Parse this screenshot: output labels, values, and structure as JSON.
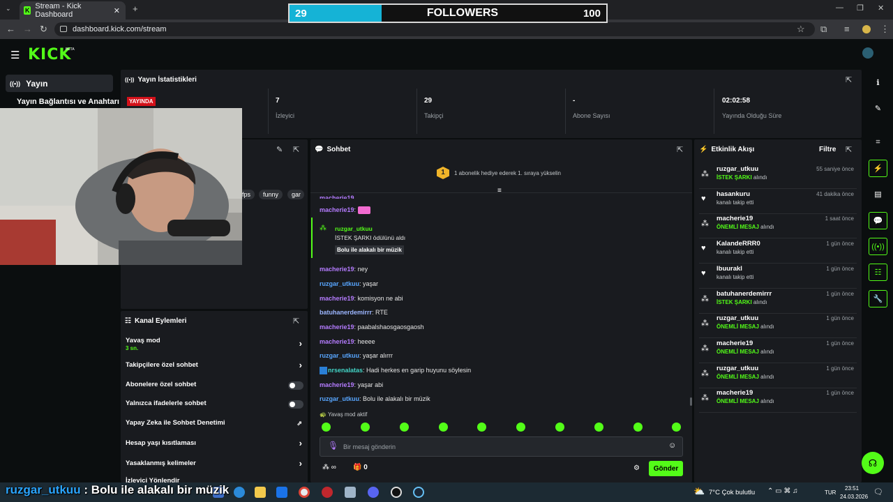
{
  "browser": {
    "tab_title": "Stream - Kick Dashboard",
    "url": "dashboard.kick.com/stream",
    "favicon_letter": "K"
  },
  "overlay": {
    "followers_current": "29",
    "followers_label": "FOLLOWERS",
    "followers_target": "100",
    "progress_fraction": 0.29
  },
  "kick": {
    "logo": "KICK",
    "beta": "BETA"
  },
  "sidebar": {
    "items": [
      {
        "label": "Yayın"
      },
      {
        "label": "Yayın Bağlantısı ve Anahtarı"
      }
    ]
  },
  "stats": {
    "title": "Yayın İstatistikleri",
    "live_badge": "YAYINDA",
    "items": [
      {
        "value": "7",
        "label": "İzleyici"
      },
      {
        "value": "29",
        "label": "Takipçi"
      },
      {
        "value": "-",
        "label": "Abone Sayısı"
      },
      {
        "value": "02:02:58",
        "label": "Yayında Olduğu Süre"
      }
    ]
  },
  "tags": [
    "fps",
    "funny",
    "gar"
  ],
  "chat": {
    "title": "Sohbet",
    "goal_badge": "1",
    "goal_text": "1 abonelik hediye ederek 1. sıraya yükselin",
    "reward": {
      "user": "ruzgar_utkuu",
      "line": "İSTEK ŞARKI ödülünü aldı",
      "message": "Bolu ile alakalı bir müzik"
    },
    "top_user": "macherie19",
    "messages": [
      {
        "user": "macherie19",
        "text": "ney",
        "cls": "u-purple"
      },
      {
        "user": "ruzgar_utkuu",
        "text": "yaşar",
        "cls": "u-blue"
      },
      {
        "user": "macherie19",
        "text": "komisyon ne abi",
        "cls": "u-purple"
      },
      {
        "user": "batuhanerdemirrr",
        "text": "RTE",
        "cls": "u-lblue"
      },
      {
        "user": "macherie19",
        "text": "paabalshaosgaosgaosh",
        "cls": "u-purple"
      },
      {
        "user": "macherie19",
        "text": "heeee",
        "cls": "u-purple"
      },
      {
        "user": "ruzgar_utkuu",
        "text": "yaşar alırrr",
        "cls": "u-blue"
      },
      {
        "user": "nrsenalatas",
        "text": "Hadi herkes en garip huyunu söylesin",
        "cls": "u-teal"
      },
      {
        "user": "macherie19",
        "text": "yaşar abi",
        "cls": "u-purple"
      },
      {
        "user": "ruzgar_utkuu",
        "text": "Bolu ile alakalı bir müzik",
        "cls": "u-blue"
      }
    ],
    "slow_mode": "Yavaş mod aktif",
    "input_placeholder": "Bir mesaj gönderin",
    "points": "∞",
    "gift_count": "0",
    "send_label": "Gönder"
  },
  "activity": {
    "title": "Etkinlik Akışı",
    "filter_label": "Filtre",
    "items": [
      {
        "user": "ruzgar_utkuu",
        "time": "55 saniye önce",
        "highlight": "İSTEK ŞARKI",
        "desc": " alındı",
        "icon": "gift"
      },
      {
        "user": "hasankuru",
        "time": "41 dakika önce",
        "highlight": "",
        "desc": "kanalı takip etti",
        "icon": "heart"
      },
      {
        "user": "macherie19",
        "time": "1 saat önce",
        "highlight": "ÖNEMLİ MESAJ",
        "desc": " alındı",
        "icon": "gift"
      },
      {
        "user": "KalandeRRR0",
        "time": "1 gün önce",
        "highlight": "",
        "desc": "kanalı takip etti",
        "icon": "heart"
      },
      {
        "user": "lbuurakl",
        "time": "1 gün önce",
        "highlight": "",
        "desc": "kanalı takip etti",
        "icon": "heart"
      },
      {
        "user": "batuhanerdemirrr",
        "time": "1 gün önce",
        "highlight": "İSTEK ŞARKI",
        "desc": " alındı",
        "icon": "gift"
      },
      {
        "user": "ruzgar_utkuu",
        "time": "1 gün önce",
        "highlight": "ÖNEMLİ MESAJ",
        "desc": " alındı",
        "icon": "gift"
      },
      {
        "user": "macherie19",
        "time": "1 gün önce",
        "highlight": "ÖNEMLİ MESAJ",
        "desc": " alındı",
        "icon": "gift"
      },
      {
        "user": "ruzgar_utkuu",
        "time": "1 gün önce",
        "highlight": "ÖNEMLİ MESAJ",
        "desc": " alındı",
        "icon": "gift"
      },
      {
        "user": "macherie19",
        "time": "1 gün önce",
        "highlight": "ÖNEMLİ MESAJ",
        "desc": " alındı",
        "icon": "gift"
      }
    ]
  },
  "channel_actions": {
    "title": "Kanal Eylemleri",
    "slow_mode_label": "Yavaş mod",
    "slow_mode_value": "3 sn.",
    "rows": [
      {
        "label": "Takipçilere özel sohbet",
        "control": "chevron"
      },
      {
        "label": "Abonelere özel sohbet",
        "control": "toggle"
      },
      {
        "label": "Yalnızca ifadelerle sohbet",
        "control": "toggle"
      },
      {
        "label": "Yapay Zeka ile Sohbet Denetimi",
        "control": "external"
      },
      {
        "label": "Hesap yaşı kısıtlaması",
        "control": "chevron"
      },
      {
        "label": "Yasaklanmış kelimeler",
        "control": "chevron"
      },
      {
        "label": "İzleyici Yönlendir",
        "control": "none"
      }
    ]
  },
  "subtitle": {
    "user": "ruzgar_utkuu",
    "text": " : Bolu ile alakalı bir müzik"
  },
  "taskbar": {
    "weather": "7°C  Çok bulutlu",
    "lang": "TUR",
    "time": "23:51",
    "date": "24.03.2026"
  },
  "colors": {
    "kick_green": "#53fc18",
    "panel": "#191b1f",
    "bg": "#0b0e0f",
    "followers_fill": "#15b3d6",
    "live_red": "#d4111a"
  }
}
